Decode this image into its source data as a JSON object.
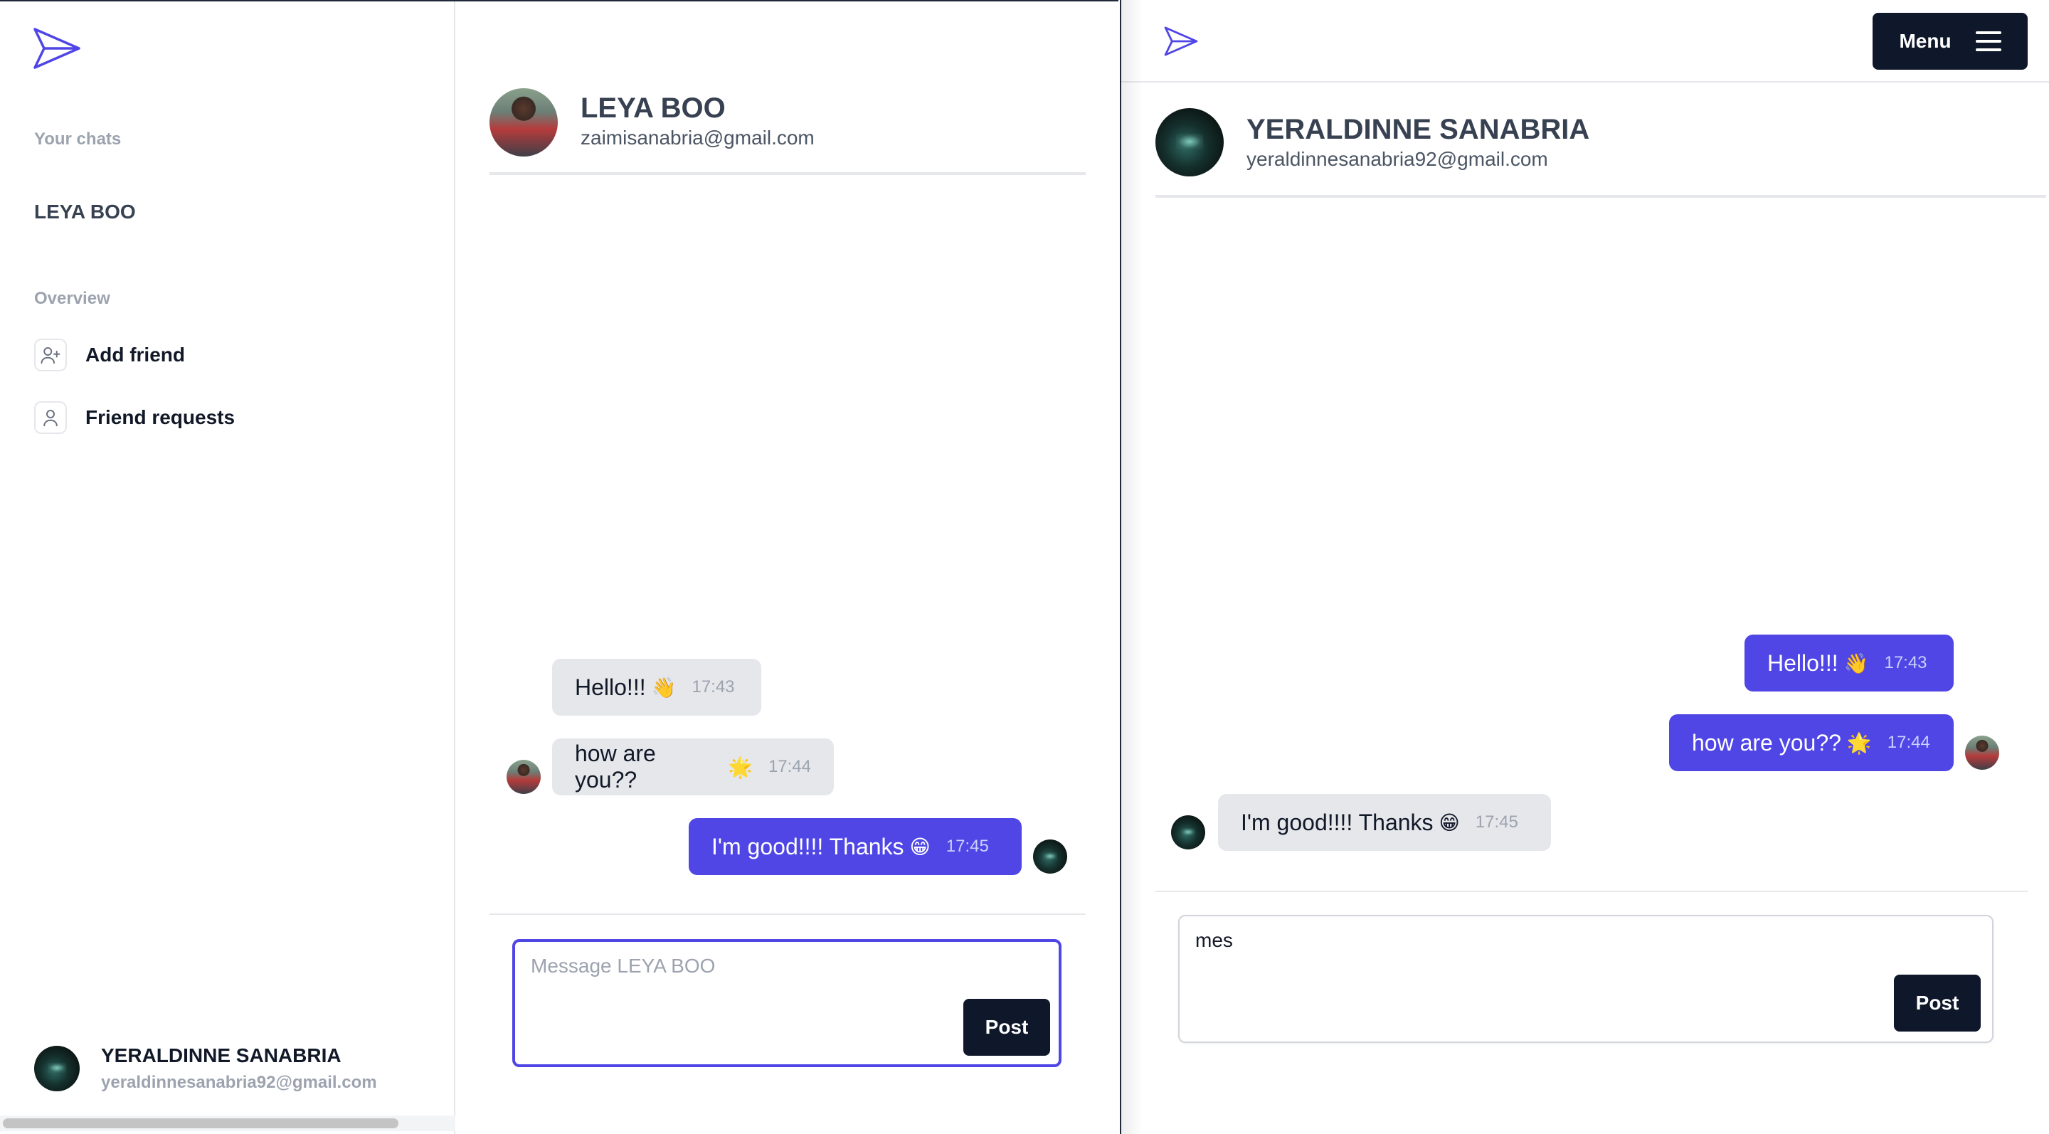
{
  "left_window": {
    "sidebar": {
      "your_chats_heading": "Your chats",
      "chats": [
        {
          "label": "LEYA BOO"
        }
      ],
      "overview_heading": "Overview",
      "nav": [
        {
          "label": "Add friend",
          "icon": "user-plus-icon"
        },
        {
          "label": "Friend requests",
          "icon": "user-icon"
        }
      ],
      "profile": {
        "name": "YERALDINNE SANABRIA",
        "email": "yeraldinnesanabria92@gmail.com"
      }
    },
    "chat": {
      "header": {
        "name": "LEYA BOO",
        "email": "zaimisanabria@gmail.com"
      },
      "messages": [
        {
          "text": "Hello!!!",
          "emoji": "👋",
          "time": "17:43",
          "from": "other"
        },
        {
          "text": "how are you??",
          "emoji": "🌟",
          "time": "17:44",
          "from": "other"
        },
        {
          "text": "I'm good!!!! Thanks",
          "emoji": "😁",
          "time": "17:45",
          "from": "me"
        }
      ],
      "composer": {
        "placeholder": "Message LEYA BOO",
        "value": "",
        "post_label": "Post"
      }
    }
  },
  "right_window": {
    "topbar": {
      "menu_label": "Menu"
    },
    "chat": {
      "header": {
        "name": "YERALDINNE SANABRIA",
        "email": "yeraldinnesanabria92@gmail.com"
      },
      "messages": [
        {
          "text": "Hello!!!",
          "emoji": "👋",
          "time": "17:43",
          "from": "me"
        },
        {
          "text": "how are you??",
          "emoji": "🌟",
          "time": "17:44",
          "from": "me"
        },
        {
          "text": "I'm good!!!! Thanks",
          "emoji": "😁",
          "time": "17:45",
          "from": "other"
        }
      ],
      "composer": {
        "placeholder": "",
        "value": "mes",
        "post_label": "Post"
      }
    }
  },
  "colors": {
    "accent": "#4f46e5",
    "dark_button": "#0f172a",
    "bubble_gray": "#e5e7eb",
    "muted_text": "#9ca3af"
  }
}
